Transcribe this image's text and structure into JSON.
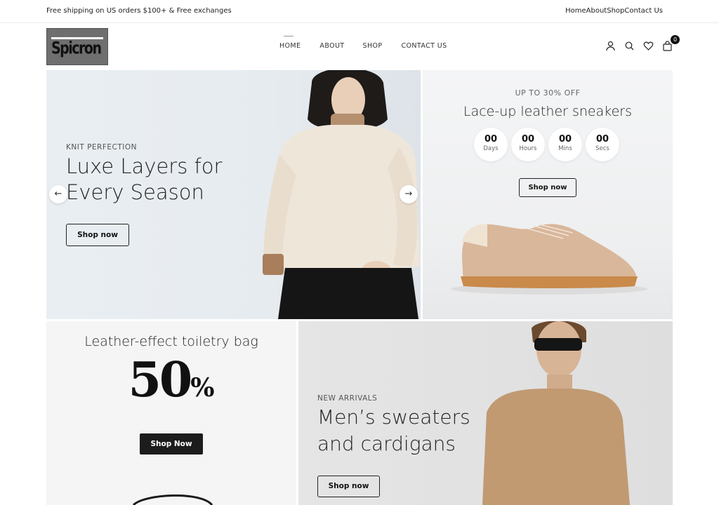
{
  "topbar": {
    "promo": "Free shipping on US orders $100+ & Free exchanges",
    "links": [
      "Home",
      "About",
      "Shop",
      "Contact Us"
    ]
  },
  "header": {
    "logo_text": "SPICRON",
    "nav": [
      "HOME",
      "ABOUT",
      "SHOP",
      "CONTACT US"
    ],
    "active_nav": "HOME",
    "icons": [
      "account-icon",
      "search-icon",
      "wishlist-icon",
      "cart-icon"
    ],
    "cart_count": "0"
  },
  "hero": {
    "eyebrow": "KNIT PERFECTION",
    "title_line1": "Luxe Layers for",
    "title_line2": "Every Season",
    "button": "Shop now"
  },
  "promo_sneakers": {
    "eyebrow": "UP TO 30% OFF",
    "title": "Lace-up leather sneakers",
    "timer": [
      {
        "num": "00",
        "label": "Days"
      },
      {
        "num": "00",
        "label": "Hours"
      },
      {
        "num": "00",
        "label": "Mins"
      },
      {
        "num": "00",
        "label": "Secs"
      }
    ],
    "button": "Shop now"
  },
  "promo_bag": {
    "title": "Leather-effect toiletry bag",
    "discount_number": "50",
    "discount_symbol": "%",
    "button": "Shop Now"
  },
  "promo_men": {
    "eyebrow": "NEW ARRIVALS",
    "title_line1": "Men’s sweaters",
    "title_line2": "and cardigans",
    "button": "Shop now"
  },
  "colors": {
    "accent_dark": "#1c1c1c",
    "sweater_cream": "#efe6da",
    "sneaker_tan": "#d9b79b",
    "sole": "#c98a4a",
    "men_sweater": "#c19a72"
  }
}
